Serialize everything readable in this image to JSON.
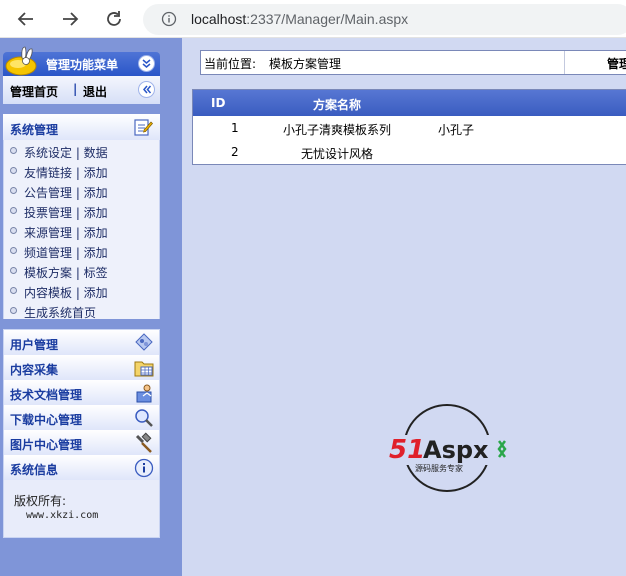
{
  "browser": {
    "url_host": "localhost",
    "url_rest": ":2337/Manager/Main.aspx"
  },
  "menu": {
    "title": "管理功能菜单",
    "home_label": "管理首页",
    "separator": "|",
    "logout_label": "退出",
    "system_panel": {
      "title": "系统管理",
      "items": [
        {
          "label": "系统设定 | 数据"
        },
        {
          "label": "友情链接 | 添加"
        },
        {
          "label": "公告管理 | 添加"
        },
        {
          "label": "投票管理 | 添加"
        },
        {
          "label": "来源管理 | 添加"
        },
        {
          "label": "频道管理 | 添加"
        },
        {
          "label": "模板方案 | 标签"
        },
        {
          "label": "内容模板 | 添加"
        },
        {
          "label": "生成系统首页"
        }
      ]
    },
    "links": [
      {
        "label": "用户管理",
        "icon": "users-diamond-icon"
      },
      {
        "label": "内容采集",
        "icon": "folder-grid-icon"
      },
      {
        "label": "技术文档管理",
        "icon": "document-person-icon"
      },
      {
        "label": "下载中心管理",
        "icon": "magnifier-icon"
      },
      {
        "label": "图片中心管理",
        "icon": "hammer-icon"
      },
      {
        "label": "系统信息",
        "icon": "info-icon"
      }
    ],
    "copyright_label": "版权所有:",
    "copyright_site": "www.xkzi.com"
  },
  "main": {
    "location_label": "当前位置:",
    "location_value": "模板方案管理",
    "location_right": "管理",
    "table": {
      "headers": [
        "ID",
        "方案名称"
      ],
      "rows": [
        {
          "id": "1",
          "name": "小孔子清爽模板系列",
          "author": "小孔子"
        },
        {
          "id": "2",
          "name": "无忧设计风格",
          "author": ""
        }
      ]
    },
    "watermark": {
      "brand_51": "51",
      "brand_aspx": "Aspx",
      "tagline": "源码服务专家"
    }
  },
  "colors": {
    "left_frame_bg": "#7f95d8",
    "main_frame_bg": "#d1d9f2",
    "header_blue": "#2a56c8",
    "accent_red": "#e0202a",
    "accent_green": "#2aa64a"
  }
}
